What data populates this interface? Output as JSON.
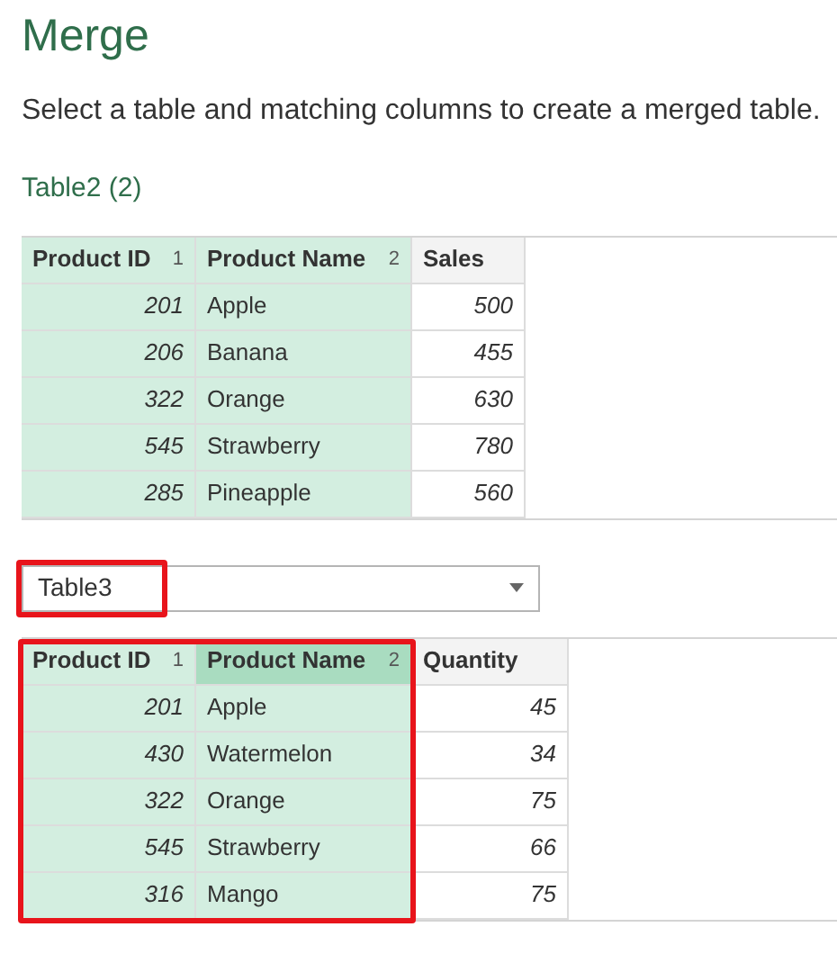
{
  "title": "Merge",
  "description": "Select a table and matching columns to create a merged table.",
  "first_table": {
    "name": "Table2 (2)",
    "columns": [
      {
        "label": "Product ID",
        "match": "1",
        "selected": true,
        "focused": false,
        "kind": "number"
      },
      {
        "label": "Product Name",
        "match": "2",
        "selected": true,
        "focused": false,
        "kind": "text"
      },
      {
        "label": "Sales",
        "selected": false,
        "focused": false,
        "kind": "number"
      }
    ],
    "rows": [
      [
        "201",
        "Apple",
        "500"
      ],
      [
        "206",
        "Banana",
        "455"
      ],
      [
        "322",
        "Orange",
        "630"
      ],
      [
        "545",
        "Strawberry",
        "780"
      ],
      [
        "285",
        "Pineapple",
        "560"
      ]
    ]
  },
  "table_select": {
    "value": "Table3",
    "highlighted": true
  },
  "second_table": {
    "highlighted": true,
    "columns": [
      {
        "label": "Product ID",
        "match": "1",
        "selected": true,
        "focused": false,
        "kind": "number"
      },
      {
        "label": "Product Name",
        "match": "2",
        "selected": true,
        "focused": true,
        "kind": "text"
      },
      {
        "label": "Quantity",
        "selected": false,
        "focused": false,
        "kind": "number"
      }
    ],
    "rows": [
      [
        "201",
        "Apple",
        "45"
      ],
      [
        "430",
        "Watermelon",
        "34"
      ],
      [
        "322",
        "Orange",
        "75"
      ],
      [
        "545",
        "Strawberry",
        "66"
      ],
      [
        "316",
        "Mango",
        "75"
      ]
    ]
  }
}
